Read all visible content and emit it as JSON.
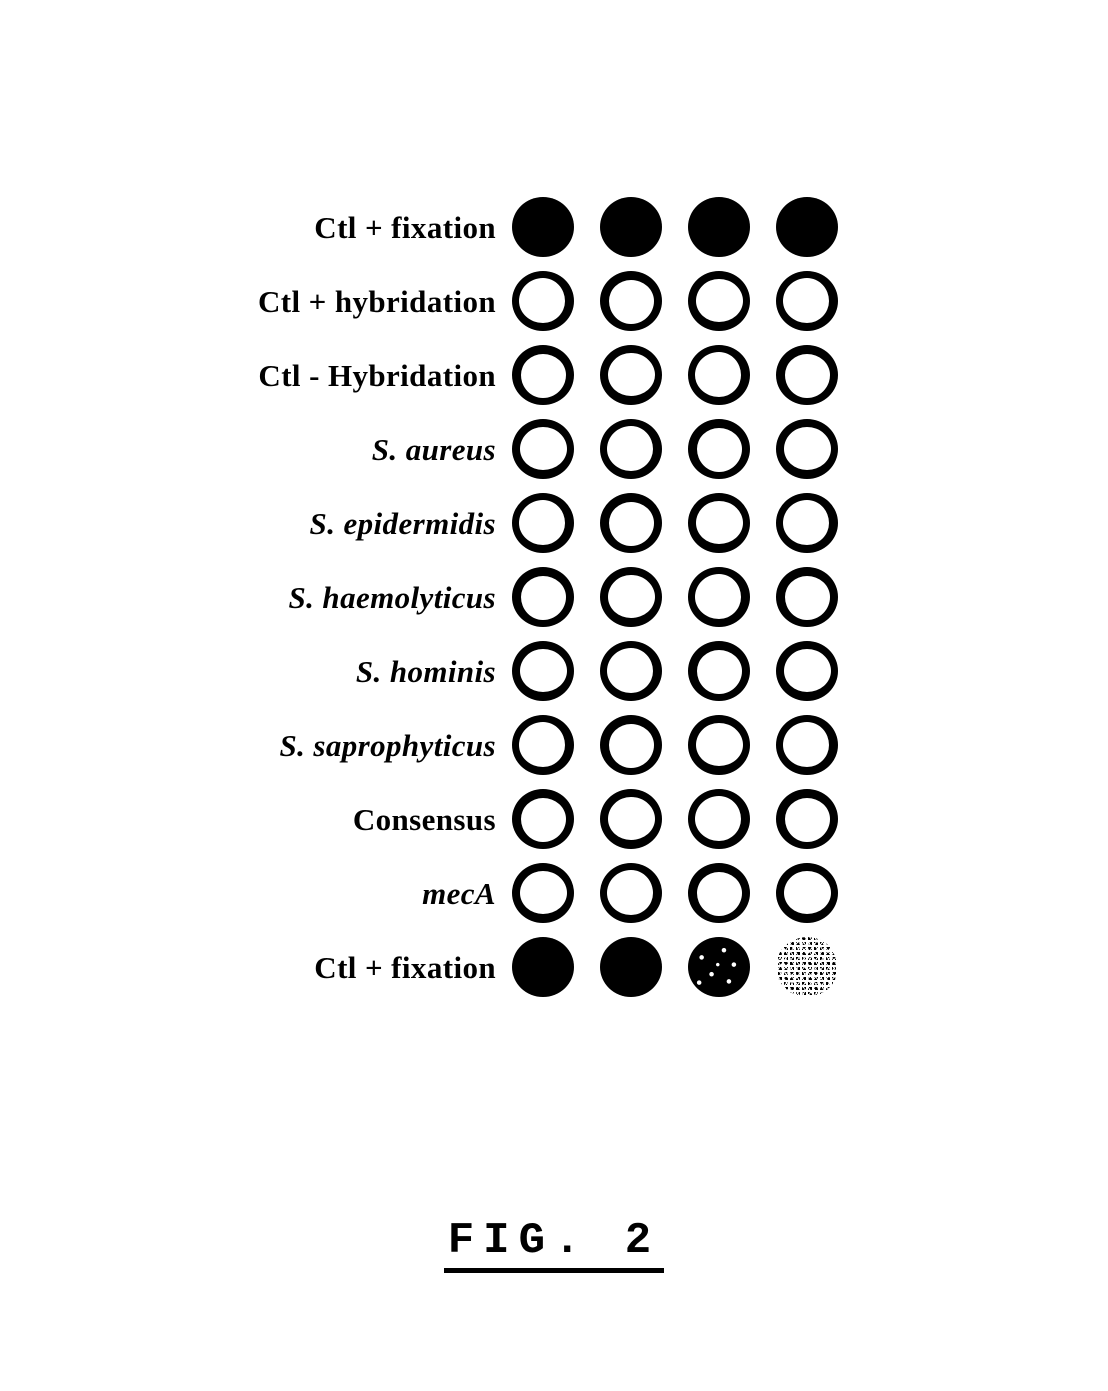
{
  "figure": {
    "caption": "FIG. 2",
    "columns": 4,
    "spot_states": {
      "filled": "solid-black-spot",
      "ring": "hollow-outlined-spot",
      "mottled": "mottled-black-spot",
      "dithered": "dithered-halftone-spot"
    },
    "rows": [
      {
        "label": "Ctl + fixation",
        "style": "upright",
        "spots": [
          "filled",
          "filled",
          "filled",
          "filled"
        ]
      },
      {
        "label": "Ctl + hybridation",
        "style": "upright",
        "spots": [
          "ring",
          "ring",
          "ring",
          "ring"
        ]
      },
      {
        "label": "Ctl - Hybridation",
        "style": "upright",
        "spots": [
          "ring",
          "ring",
          "ring",
          "ring"
        ]
      },
      {
        "label": "S. aureus",
        "style": "italic",
        "spots": [
          "ring",
          "ring",
          "ring",
          "ring"
        ]
      },
      {
        "label": "S. epidermidis",
        "style": "italic",
        "spots": [
          "ring",
          "ring",
          "ring",
          "ring"
        ]
      },
      {
        "label": "S. haemolyticus",
        "style": "italic",
        "spots": [
          "ring",
          "ring",
          "ring",
          "ring"
        ]
      },
      {
        "label": "S. hominis",
        "style": "italic",
        "spots": [
          "ring",
          "ring",
          "ring",
          "ring"
        ]
      },
      {
        "label": "S. saprophyticus",
        "style": "italic",
        "spots": [
          "ring",
          "ring",
          "ring",
          "ring"
        ]
      },
      {
        "label": "Consensus",
        "style": "upright",
        "spots": [
          "ring",
          "ring",
          "ring",
          "ring"
        ]
      },
      {
        "label": "mecA",
        "style": "italic",
        "spots": [
          "ring",
          "ring",
          "ring",
          "ring"
        ]
      },
      {
        "label": "Ctl + fixation",
        "style": "upright",
        "spots": [
          "filled",
          "filled",
          "mottled",
          "dithered"
        ]
      }
    ]
  },
  "colors": {
    "ink": "#000000",
    "paper": "#ffffff"
  }
}
